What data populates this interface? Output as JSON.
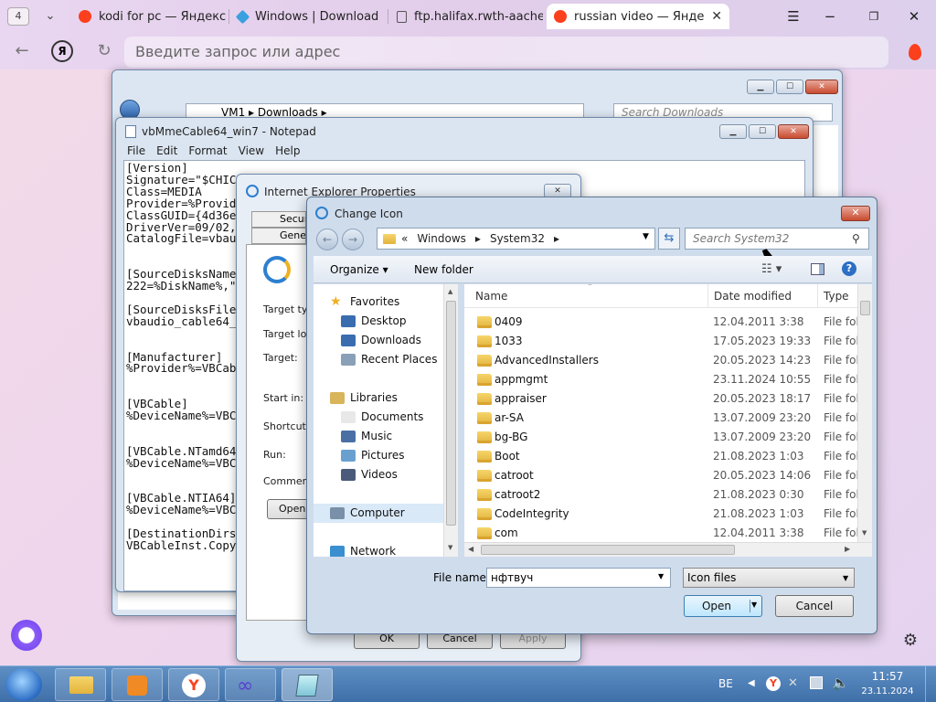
{
  "browser": {
    "tab_count": "4",
    "tabs": [
      {
        "title": "kodi for pc — Яндекс",
        "icon_color": "#fc3f1d"
      },
      {
        "title": "Windows | Download",
        "icon_color": "#3aa0e0"
      },
      {
        "title": "ftp.halifax.rwth-aache",
        "icon_color": "#666666"
      },
      {
        "title": "russian video — Яндек",
        "icon_color": "#fc3f1d"
      }
    ],
    "address_placeholder": "Введите запрос или адрес",
    "yandex_letter": "Я"
  },
  "explorer": {
    "path": [
      "VM1",
      "Downloads"
    ],
    "search_placeholder": "Search Downloads"
  },
  "notepad": {
    "title": "vbMmeCable64_win7 - Notepad",
    "menu": [
      "File",
      "Edit",
      "Format",
      "View",
      "Help"
    ],
    "text": "[Version]\nSignature=\"$CHIC\nClass=MEDIA\nProvider=%Provid\nClassGUID={4d36e\nDriverVer=09/02,\nCatalogFile=vbau\n\n\n[SourceDisksName\n222=%DiskName%,\"\n\n[SourceDisksFile\nvbaudio_cable64_\n\n\n[Manufacturer]\n%Provider%=VBCab\n\n\n[VBCable]\n%DeviceName%=VBC\n\n\n[VBCable.NTamd64\n%DeviceName%=VBC\n\n\n[VBCable.NTIA64]\n%DeviceName%=VBC\n\n[DestinationDirs\nVBCableInst.Copy"
  },
  "ie_props": {
    "title": "Internet Explorer Properties",
    "tabs": [
      "Securi",
      "Gene"
    ],
    "labels": [
      "Target ty",
      "Target lo",
      "Target:",
      "Start in:",
      "Shortcut",
      "Run:",
      "Commen"
    ],
    "open_btn": "Open",
    "ok": "OK",
    "cancel": "Cancel",
    "apply": "Apply"
  },
  "dialog": {
    "title": "Change Icon",
    "path_prefix": "«",
    "path": [
      "Windows",
      "System32"
    ],
    "search_placeholder": "Search System32",
    "organize": "Organize",
    "new_folder": "New folder",
    "nav": [
      {
        "label": "Favorites",
        "kind": "star",
        "indent": 0
      },
      {
        "label": "Desktop",
        "kind": "desk",
        "indent": 1
      },
      {
        "label": "Downloads",
        "kind": "dl",
        "indent": 1
      },
      {
        "label": "Recent Places",
        "kind": "recent",
        "indent": 1
      },
      {
        "label": "",
        "kind": "gap",
        "indent": 0
      },
      {
        "label": "Libraries",
        "kind": "lib",
        "indent": 0
      },
      {
        "label": "Documents",
        "kind": "doc",
        "indent": 1
      },
      {
        "label": "Music",
        "kind": "music",
        "indent": 1
      },
      {
        "label": "Pictures",
        "kind": "pic",
        "indent": 1
      },
      {
        "label": "Videos",
        "kind": "vid",
        "indent": 1
      },
      {
        "label": "",
        "kind": "gap",
        "indent": 0
      },
      {
        "label": "Computer",
        "kind": "comp",
        "indent": 0,
        "selected": true
      },
      {
        "label": "",
        "kind": "gap",
        "indent": 0
      },
      {
        "label": "Network",
        "kind": "net",
        "indent": 0
      }
    ],
    "columns": {
      "name": "Name",
      "date": "Date modified",
      "type": "Type"
    },
    "files": [
      {
        "name": "0409",
        "date": "12.04.2011 3:38",
        "type": "File fol"
      },
      {
        "name": "1033",
        "date": "17.05.2023 19:33",
        "type": "File fol"
      },
      {
        "name": "AdvancedInstallers",
        "date": "20.05.2023 14:23",
        "type": "File fol"
      },
      {
        "name": "appmgmt",
        "date": "23.11.2024 10:55",
        "type": "File fol"
      },
      {
        "name": "appraiser",
        "date": "20.05.2023 18:17",
        "type": "File fol"
      },
      {
        "name": "ar-SA",
        "date": "13.07.2009 23:20",
        "type": "File fol"
      },
      {
        "name": "bg-BG",
        "date": "13.07.2009 23:20",
        "type": "File fol"
      },
      {
        "name": "Boot",
        "date": "21.08.2023 1:03",
        "type": "File fol"
      },
      {
        "name": "catroot",
        "date": "20.05.2023 14:06",
        "type": "File fol"
      },
      {
        "name": "catroot2",
        "date": "21.08.2023 0:30",
        "type": "File fol"
      },
      {
        "name": "CodeIntegrity",
        "date": "21.08.2023 1:03",
        "type": "File fol"
      },
      {
        "name": "com",
        "date": "12.04.2011 3:38",
        "type": "File fol"
      }
    ],
    "file_name_label": "File name:",
    "file_name_value": "нфтвуч",
    "file_type": "Icon files",
    "open": "Open",
    "cancel": "Cancel"
  },
  "taskbar": {
    "lang": "BE",
    "time": "11:57",
    "date": "23.11.2024"
  }
}
